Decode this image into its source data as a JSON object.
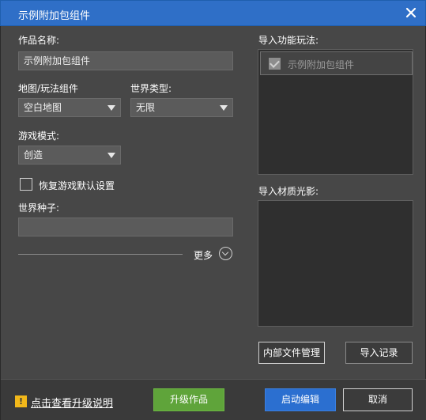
{
  "window": {
    "title": "示例附加包组件",
    "close_icon": "close-icon"
  },
  "form": {
    "work_name_label": "作品名称:",
    "work_name_value": "示例附加包组件",
    "map_label": "地图/玩法组件",
    "map_value": "空白地图",
    "world_type_label": "世界类型:",
    "world_type_value": "无限",
    "game_mode_label": "游戏模式:",
    "game_mode_value": "创造",
    "restore_default_label": "恢复游戏默认设置",
    "restore_default_checked": false,
    "seed_label": "世界种子:",
    "seed_value": "",
    "more_label": "更多"
  },
  "right": {
    "import_features_label": "导入功能玩法:",
    "import_features_items": [
      {
        "label": "示例附加包组件",
        "checked": true
      }
    ],
    "import_materials_label": "导入材质光影:",
    "internal_file_button": "内部文件管理",
    "import_record_button": "导入记录"
  },
  "footer": {
    "warning_icon": "warning-icon",
    "upgrade_info_link": "点击查看升级说明",
    "upgrade_button": "升级作品",
    "launch_edit_button": "启动编辑",
    "cancel_button": "取消"
  },
  "colors": {
    "titlebar": "#2f6fc7",
    "window_bg": "#474747",
    "green_button": "#5fa43a",
    "blue_button": "#2b6fd0",
    "warning": "#f2b81a"
  }
}
